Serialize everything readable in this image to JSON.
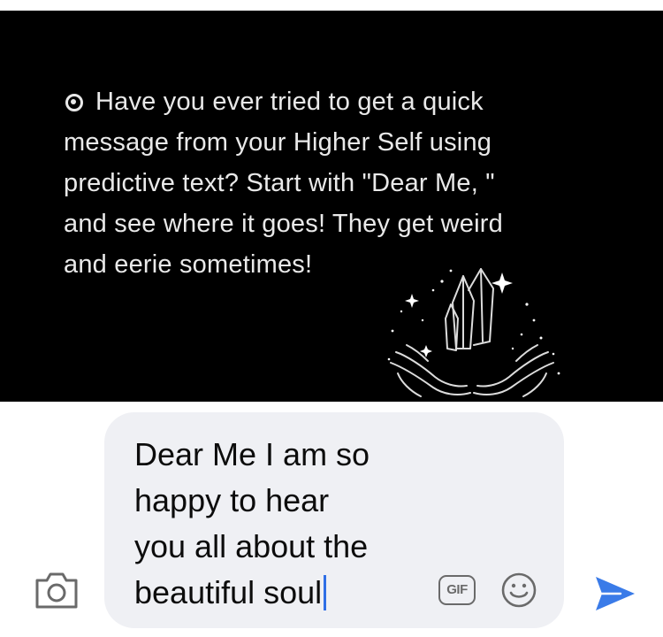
{
  "post": {
    "text": "Have you ever tried to get a quick\nmessage from your Higher Self using\npredictive text? Start with \"Dear Me, \"\nand see where it goes! They get weird\nand eerie sometimes!"
  },
  "composer": {
    "text": "Dear Me I am so\nhappy to hear\nyou all about the\nbeautiful soul",
    "gif_label": "GIF"
  },
  "icons": {
    "eye": "eye-icon",
    "crystal": "crystal-hands-icon",
    "camera": "camera-icon",
    "gif": "gif-icon",
    "emoji": "smiley-icon",
    "send": "send-icon"
  },
  "colors": {
    "image_bg": "#000000",
    "image_text": "#e9e9e9",
    "bubble_bg": "#eff0f4",
    "caret": "#2f6fe6",
    "send": "#3a7be8",
    "icon_gray": "#6a6a6a"
  }
}
